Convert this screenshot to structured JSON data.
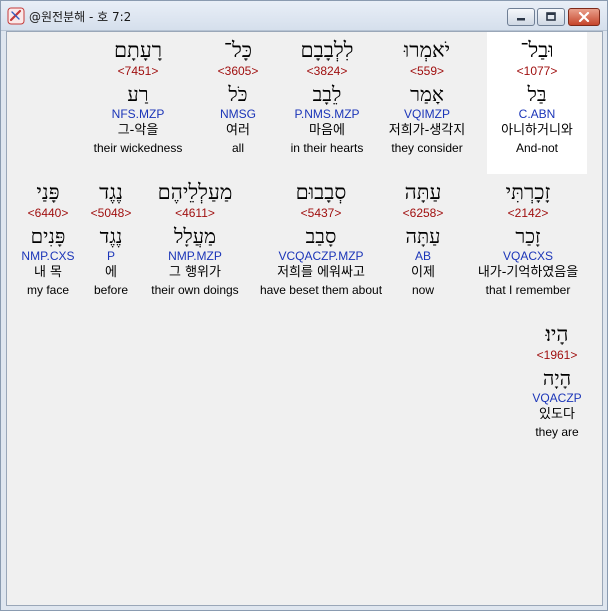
{
  "window": {
    "title": "@원전분해 - 호 7:2"
  },
  "words": [
    {
      "heb": "וּבַל־",
      "strong": "<1077>",
      "lemma": "בַּל",
      "parse": "C.ABN",
      "kor": "아니하거니와",
      "eng": "And-not"
    },
    {
      "heb": "יֹאמְרוּ",
      "strong": "<559>",
      "lemma": "אָמַר",
      "parse": "VQIMZP",
      "kor": "저희가-생각지",
      "eng": "they consider"
    },
    {
      "heb": "לִלְבָבָם",
      "strong": "<3824>",
      "lemma": "לֵבָב",
      "parse": "P.NMS.MZP",
      "kor": "마음에",
      "eng": "in their hearts"
    },
    {
      "heb": "כָּל־",
      "strong": "<3605>",
      "lemma": "כֹּל",
      "parse": "NMSG",
      "kor": "여러",
      "eng": "all"
    },
    {
      "heb": "רָעָתָם",
      "strong": "<7451>",
      "lemma": "רַע",
      "parse": "NFS.MZP",
      "kor": "그-악을",
      "eng": "their wickedness"
    },
    {
      "heb": "זָכָרְתִּי",
      "strong": "<2142>",
      "lemma": "זָכַר",
      "parse": "VQACXS",
      "kor": "내가-기억하였음을",
      "eng": "that I remember"
    },
    {
      "heb": "עַתָּה",
      "strong": "<6258>",
      "lemma": "עַתָּה",
      "parse": "AB",
      "kor": "이제",
      "eng": "now"
    },
    {
      "heb": "סְבָבוּם",
      "strong": "<5437>",
      "lemma": "סָבַב",
      "parse": "VCQACZP.MZP",
      "kor": "저희를 에워싸고",
      "eng": "have beset them about"
    },
    {
      "heb": "מַעַלְלֵיהֶם",
      "strong": "<4611>",
      "lemma": "מַעֲלָל",
      "parse": "NMP.MZP",
      "kor": "그 행위가",
      "eng": "their own doings"
    },
    {
      "heb": "נֶגֶד",
      "strong": "<5048>",
      "lemma": "נֶגֶד",
      "parse": "P",
      "kor": "에",
      "eng": "before"
    },
    {
      "heb": "פָּנַי",
      "strong": "<6440>",
      "lemma": "פָּנִים",
      "parse": "NMP.CXS",
      "kor": "내 목",
      "eng": "my face"
    },
    {
      "heb": "הָיוּ׃",
      "strong": "<1961>",
      "lemma": "הָיָה",
      "parse": "VQACZP",
      "kor": "있도다",
      "eng": "they are"
    }
  ]
}
